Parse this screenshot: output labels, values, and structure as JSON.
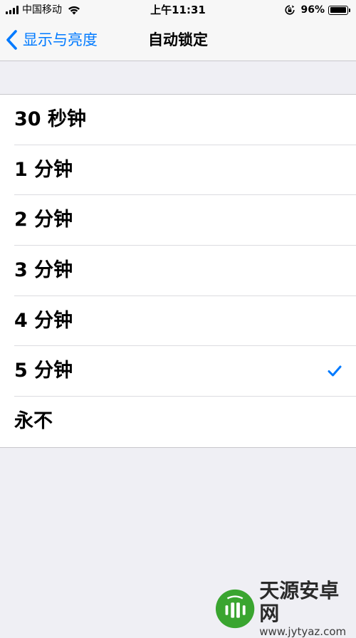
{
  "status_bar": {
    "carrier": "中国移动",
    "time": "上午11:31",
    "battery_percent": "96%",
    "battery_level": 0.96
  },
  "nav": {
    "back_label": "显示与亮度",
    "title": "自动锁定"
  },
  "options": [
    {
      "label": "30 秒钟",
      "selected": false
    },
    {
      "label": "1 分钟",
      "selected": false
    },
    {
      "label": "2 分钟",
      "selected": false
    },
    {
      "label": "3 分钟",
      "selected": false
    },
    {
      "label": "4 分钟",
      "selected": false
    },
    {
      "label": "5 分钟",
      "selected": true
    },
    {
      "label": "永不",
      "selected": false
    }
  ],
  "watermark": {
    "name": "天源安卓网",
    "url": "www.jytyaz.com"
  },
  "colors": {
    "accent": "#007aff",
    "background": "#efeff4",
    "watermark_green": "#3aa530"
  }
}
